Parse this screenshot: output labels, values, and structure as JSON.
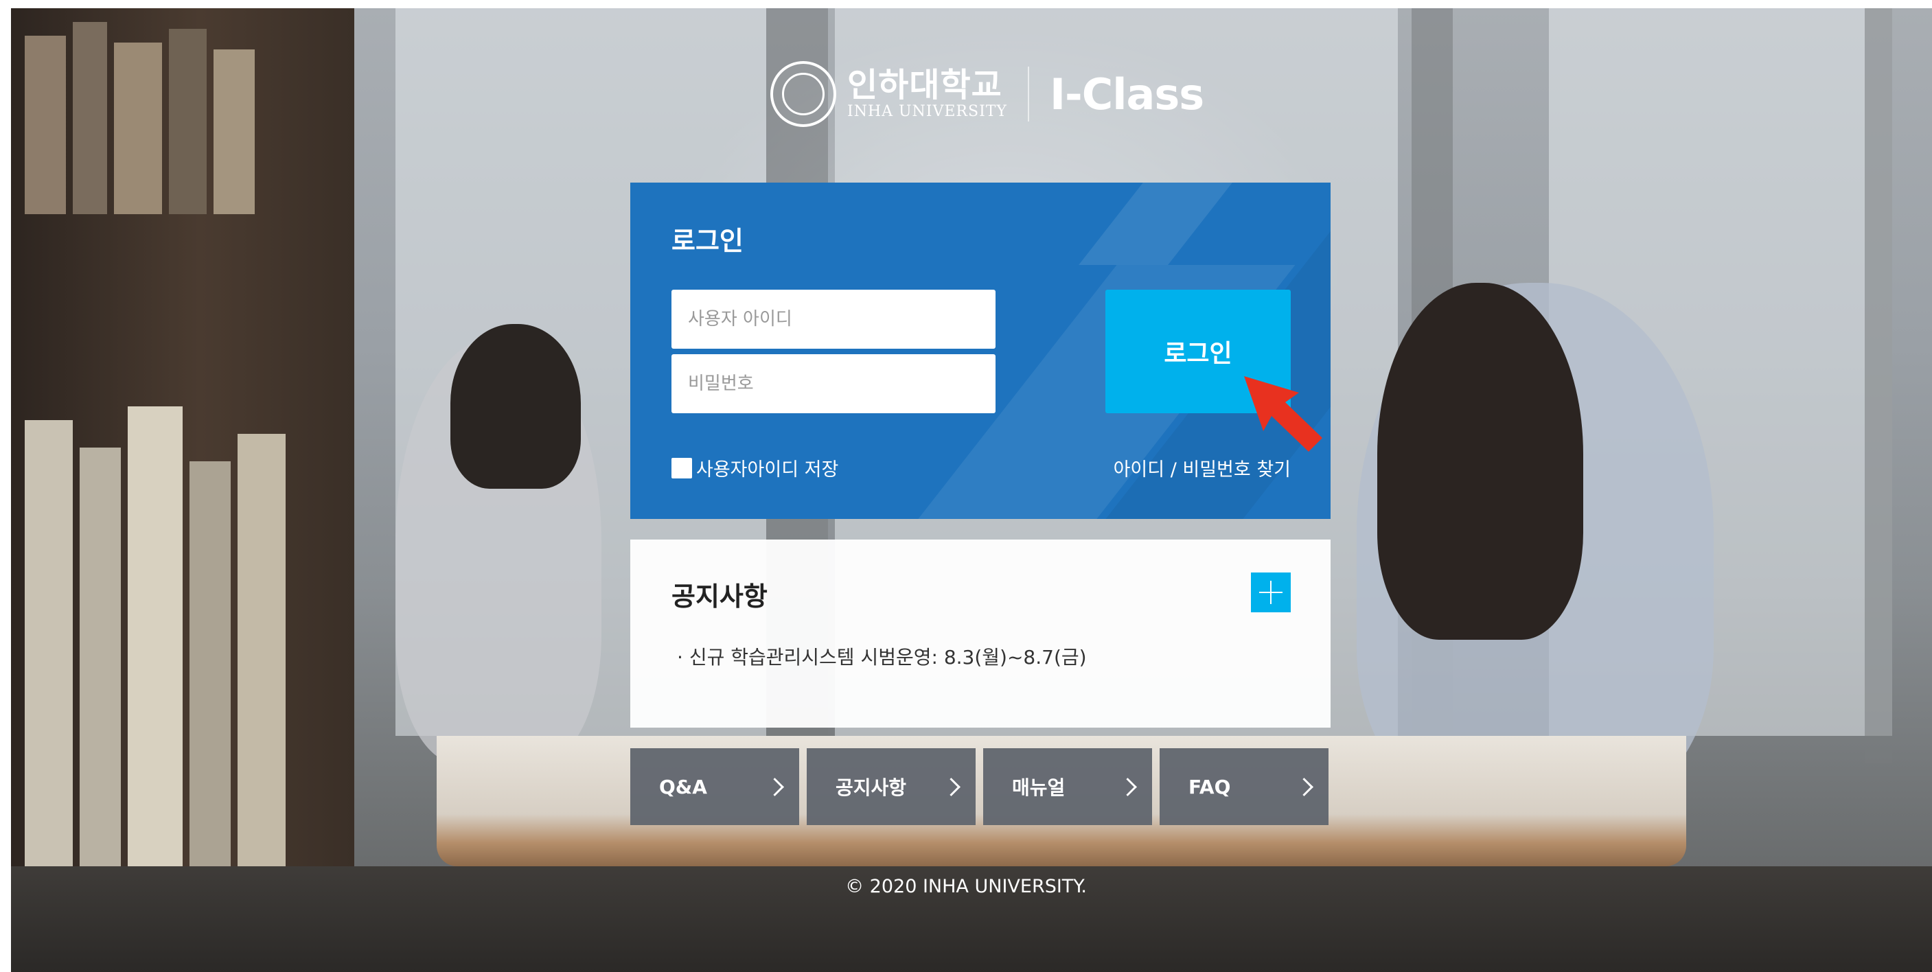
{
  "brand": {
    "university_ko": "인하대학교",
    "university_en": "INHA UNIVERSITY",
    "app_title": "I-Class"
  },
  "login": {
    "title": "로그인",
    "username_placeholder": "사용자 아이디",
    "password_placeholder": "비밀번호",
    "submit_label": "로그인",
    "remember_label": "사용자아이디 저장",
    "find_link": "아이디 / 비밀번호 찾기"
  },
  "notice": {
    "title": "공지사항",
    "items": [
      "신규 학습관리시스템 시범운영: 8.3(월)~8.7(금)"
    ]
  },
  "nav": [
    "Q&A",
    "공지사항",
    "매뉴얼",
    "FAQ"
  ],
  "footer": {
    "copyright": "© 2020 INHA UNIVERSITY."
  },
  "colors": {
    "login_panel": "#1e73be",
    "accent": "#00b1ec",
    "nav_button": "#60656e",
    "annotation_arrow": "#e8311f"
  },
  "icons": [
    "university-seal-icon",
    "plus-icon",
    "chevron-right-icon",
    "annotation-arrow-icon"
  ]
}
